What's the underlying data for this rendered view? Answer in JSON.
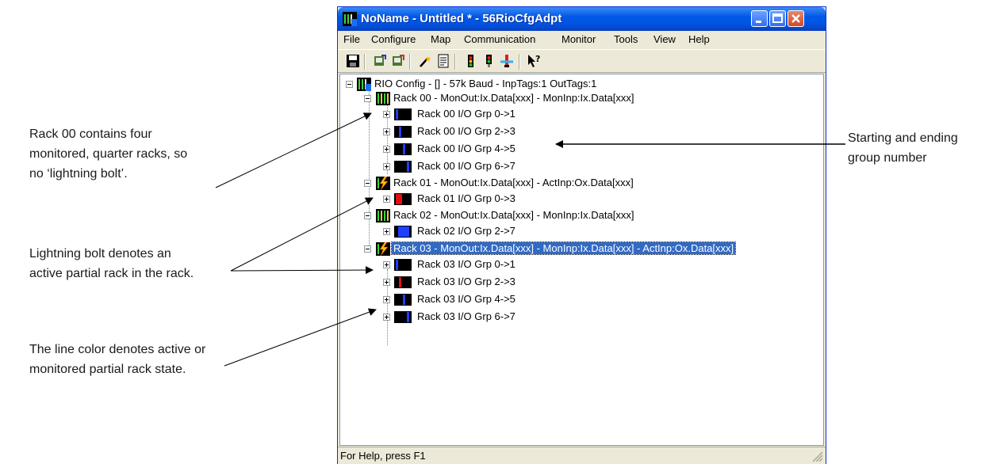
{
  "callouts": {
    "rack00": [
      "Rack 00 contains four",
      "monitored, quarter racks, so",
      "no ‘lightning bolt’."
    ],
    "lightning": [
      "Lightning bolt denotes an",
      "active partial rack in the rack."
    ],
    "linecolor": [
      "The line color denotes active or",
      "monitored partial rack state."
    ],
    "grouping": [
      "Starting and ending",
      "group number"
    ]
  },
  "window": {
    "title": "NoName - Untitled * - 56RioCfgAdpt",
    "menu": [
      "File",
      "Configure",
      "Map",
      "Communication",
      "Monitor",
      "Tools",
      "View",
      "Help"
    ],
    "status": "For Help, press F1"
  },
  "tree": {
    "root": "RIO Config - [] -  57k Baud - InpTags:1 OutTags:1",
    "racks": [
      {
        "label": "Rack 00 - MonOut:Ix.Data[xxx] - MonInp:Ix.Data[xxx]",
        "icon": "rack-icon",
        "groups": [
          {
            "label": "Rack 00 I/O Grp 0->1",
            "color": "#1f3fff"
          },
          {
            "label": "Rack 00 I/O Grp 2->3",
            "color": "#1f3fff"
          },
          {
            "label": "Rack 00 I/O Grp 4->5",
            "color": "#1f3fff"
          },
          {
            "label": "Rack 00 I/O Grp 6->7",
            "color": "#1f3fff"
          }
        ]
      },
      {
        "label": "Rack 01 - MonOut:Ix.Data[xxx] - ActInp:Ox.Data[xxx]",
        "icon": "lightning-icon",
        "groups": [
          {
            "label": "Rack 01 I/O Grp 0->3",
            "color": "#e01010"
          }
        ]
      },
      {
        "label": "Rack 02 - MonOut:Ix.Data[xxx] - MonInp:Ix.Data[xxx]",
        "icon": "rack-icon",
        "groups": [
          {
            "label": "Rack 02 I/O Grp 2->7",
            "color": "#1f3fff"
          }
        ]
      },
      {
        "label": "Rack 03 - MonOut:Ix.Data[xxx] - MonInp:Ix.Data[xxx] - ActInp:Ox.Data[xxx]",
        "icon": "lightning-icon",
        "selected": true,
        "groups": [
          {
            "label": "Rack 03 I/O Grp 0->1",
            "color": "#1f3fff"
          },
          {
            "label": "Rack 03 I/O Grp 2->3",
            "color": "#e01010"
          },
          {
            "label": "Rack 03 I/O Grp 4->5",
            "color": "#1f3fff"
          },
          {
            "label": "Rack 03 I/O Grp 6->7",
            "color": "#1f3fff"
          }
        ]
      }
    ]
  },
  "colors": {
    "titlebar": "#0054e3",
    "selection": "#316ac5",
    "active": "#e01010",
    "monitored": "#1f3fff"
  }
}
